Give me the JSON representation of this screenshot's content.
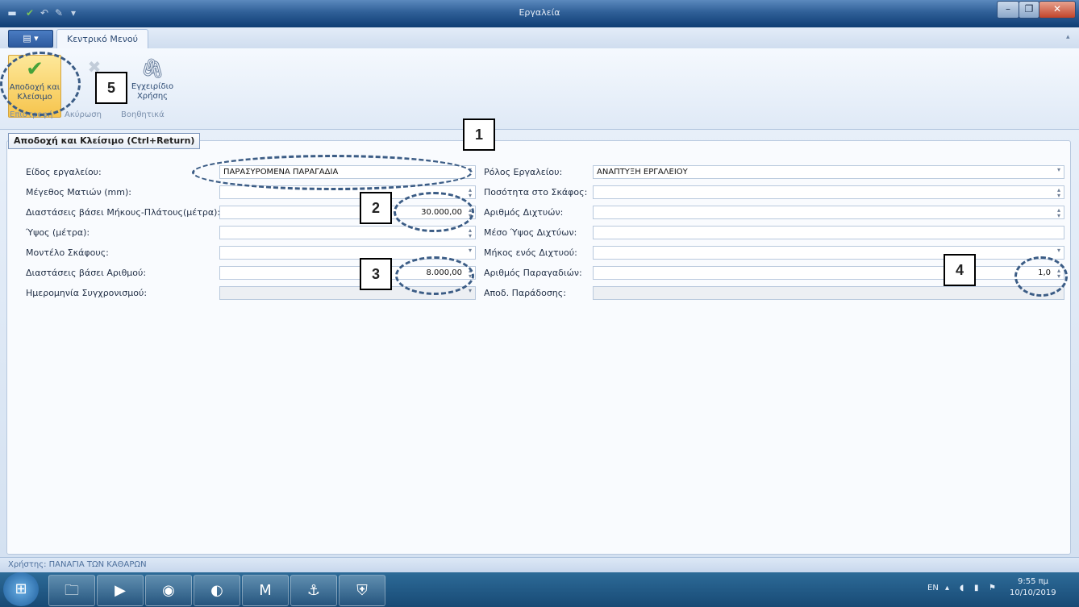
{
  "window": {
    "title": "Εργαλεία"
  },
  "ribbon": {
    "tab": "Κεντρικό Μενού",
    "accept_label": "Αποδοχή και Κλείσιμο",
    "cancel_label": "",
    "manual_label": "Εγχειρίδιο Χρήσης",
    "group_labels": [
      "Επιστροφή",
      "Ακύρωση",
      "Βοηθητικά"
    ]
  },
  "tooltip": "Αποδοχή και Κλείσιμο (Ctrl+Return)",
  "form": {
    "left": [
      {
        "label": "Είδος εργαλείου:",
        "value": "ΠΑΡΑΣΥΡΟΜΕΝΑ ΠΑΡΑΓΑΔΙΑ",
        "align": "left"
      },
      {
        "label": "Μέγεθος Ματιών (mm):",
        "value": "",
        "align": "right"
      },
      {
        "label": "Διαστάσεις βάσει Μήκους-Πλάτους(μέτρα):",
        "value": "30.000,00",
        "align": "right"
      },
      {
        "label": "Ύψος (μέτρα):",
        "value": "",
        "align": "right"
      },
      {
        "label": "Μοντέλο Σκάφους:",
        "value": "",
        "align": "right"
      },
      {
        "label": "Διαστάσεις βάσει Αριθμού:",
        "value": "8.000,00",
        "align": "right"
      },
      {
        "label": "Ημερομηνία Συγχρονισμού:",
        "value": "",
        "align": "right"
      }
    ],
    "right": [
      {
        "label": "Ρόλος Εργαλείου:",
        "value": "ΑΝΑΠΤΥΞΗ ΕΡΓΑΛΕΙΟΥ",
        "align": "left"
      },
      {
        "label": "Ποσότητα στο Σκάφος:",
        "value": "",
        "align": "right"
      },
      {
        "label": "Αριθμός Διχτυών:",
        "value": "",
        "align": "right"
      },
      {
        "label": "Μέσο Ύψος Διχτύων:",
        "value": "",
        "align": "right"
      },
      {
        "label": "Μήκος ενός Διχτυού:",
        "value": "",
        "align": "right"
      },
      {
        "label": "Αριθμός Παραγαδιών:",
        "value": "1,0",
        "align": "right"
      },
      {
        "label": "Αποδ. Παράδοσης:",
        "value": "",
        "align": "right"
      }
    ]
  },
  "annotations": [
    "1",
    "2",
    "3",
    "4",
    "5"
  ],
  "status": {
    "user": "Χρήστης: ΠΑΝΑΓΙΑ ΤΩΝ ΚΑΘΑΡΩΝ"
  },
  "tray": {
    "lang": "EN",
    "time": "9:55 πμ",
    "date": "10/10/2019"
  }
}
